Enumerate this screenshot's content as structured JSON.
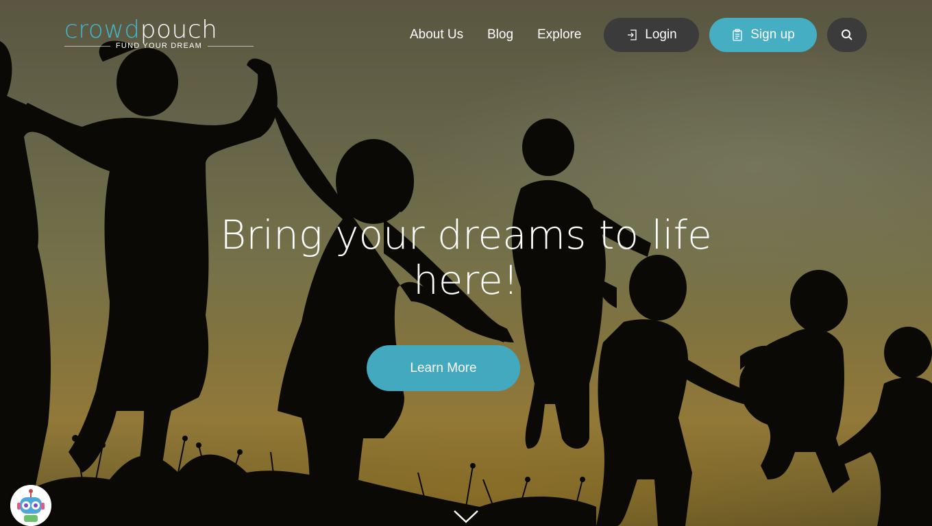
{
  "brand": {
    "logo_part1": "crowd",
    "logo_part2": "pouch",
    "tagline": "FUND YOUR DREAM"
  },
  "nav": {
    "links": [
      "About Us",
      "Blog",
      "Explore"
    ],
    "login_label": "Login",
    "signup_label": "Sign up",
    "search_icon": "search-icon"
  },
  "hero": {
    "headline": "Bring your dreams to life here!",
    "cta_label": "Learn More",
    "scroll_icon": "chevron-down-icon"
  },
  "widget": {
    "icon": "robot-chat-icon"
  },
  "colors": {
    "accent": "#45aec3",
    "dark_button": "#3b3b3b",
    "text": "#ffffff"
  }
}
